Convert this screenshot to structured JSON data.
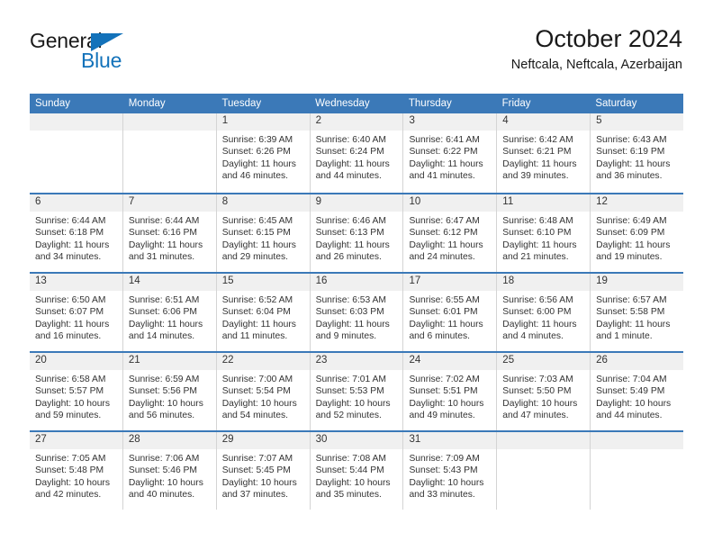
{
  "brand": {
    "name_dark": "General",
    "name_blue": "Blue",
    "triangle_color": "#1372ba"
  },
  "header": {
    "title": "October 2024",
    "subtitle": "Neftcala, Neftcala, Azerbaijan"
  },
  "theme": {
    "header_blue": "#3b79b8",
    "daynum_bg": "#f0f0f0",
    "cell_border": "#d4d4d4",
    "text": "#333333"
  },
  "weekday_headers": [
    "Sunday",
    "Monday",
    "Tuesday",
    "Wednesday",
    "Thursday",
    "Friday",
    "Saturday"
  ],
  "weeks": [
    [
      {
        "day": "",
        "sunrise": "",
        "sunset": "",
        "daylight_1": "",
        "daylight_2": "",
        "empty": true
      },
      {
        "day": "",
        "sunrise": "",
        "sunset": "",
        "daylight_1": "",
        "daylight_2": "",
        "empty": true
      },
      {
        "day": "1",
        "sunrise": "Sunrise: 6:39 AM",
        "sunset": "Sunset: 6:26 PM",
        "daylight_1": "Daylight: 11 hours",
        "daylight_2": "and 46 minutes."
      },
      {
        "day": "2",
        "sunrise": "Sunrise: 6:40 AM",
        "sunset": "Sunset: 6:24 PM",
        "daylight_1": "Daylight: 11 hours",
        "daylight_2": "and 44 minutes."
      },
      {
        "day": "3",
        "sunrise": "Sunrise: 6:41 AM",
        "sunset": "Sunset: 6:22 PM",
        "daylight_1": "Daylight: 11 hours",
        "daylight_2": "and 41 minutes."
      },
      {
        "day": "4",
        "sunrise": "Sunrise: 6:42 AM",
        "sunset": "Sunset: 6:21 PM",
        "daylight_1": "Daylight: 11 hours",
        "daylight_2": "and 39 minutes."
      },
      {
        "day": "5",
        "sunrise": "Sunrise: 6:43 AM",
        "sunset": "Sunset: 6:19 PM",
        "daylight_1": "Daylight: 11 hours",
        "daylight_2": "and 36 minutes."
      }
    ],
    [
      {
        "day": "6",
        "sunrise": "Sunrise: 6:44 AM",
        "sunset": "Sunset: 6:18 PM",
        "daylight_1": "Daylight: 11 hours",
        "daylight_2": "and 34 minutes."
      },
      {
        "day": "7",
        "sunrise": "Sunrise: 6:44 AM",
        "sunset": "Sunset: 6:16 PM",
        "daylight_1": "Daylight: 11 hours",
        "daylight_2": "and 31 minutes."
      },
      {
        "day": "8",
        "sunrise": "Sunrise: 6:45 AM",
        "sunset": "Sunset: 6:15 PM",
        "daylight_1": "Daylight: 11 hours",
        "daylight_2": "and 29 minutes."
      },
      {
        "day": "9",
        "sunrise": "Sunrise: 6:46 AM",
        "sunset": "Sunset: 6:13 PM",
        "daylight_1": "Daylight: 11 hours",
        "daylight_2": "and 26 minutes."
      },
      {
        "day": "10",
        "sunrise": "Sunrise: 6:47 AM",
        "sunset": "Sunset: 6:12 PM",
        "daylight_1": "Daylight: 11 hours",
        "daylight_2": "and 24 minutes."
      },
      {
        "day": "11",
        "sunrise": "Sunrise: 6:48 AM",
        "sunset": "Sunset: 6:10 PM",
        "daylight_1": "Daylight: 11 hours",
        "daylight_2": "and 21 minutes."
      },
      {
        "day": "12",
        "sunrise": "Sunrise: 6:49 AM",
        "sunset": "Sunset: 6:09 PM",
        "daylight_1": "Daylight: 11 hours",
        "daylight_2": "and 19 minutes."
      }
    ],
    [
      {
        "day": "13",
        "sunrise": "Sunrise: 6:50 AM",
        "sunset": "Sunset: 6:07 PM",
        "daylight_1": "Daylight: 11 hours",
        "daylight_2": "and 16 minutes."
      },
      {
        "day": "14",
        "sunrise": "Sunrise: 6:51 AM",
        "sunset": "Sunset: 6:06 PM",
        "daylight_1": "Daylight: 11 hours",
        "daylight_2": "and 14 minutes."
      },
      {
        "day": "15",
        "sunrise": "Sunrise: 6:52 AM",
        "sunset": "Sunset: 6:04 PM",
        "daylight_1": "Daylight: 11 hours",
        "daylight_2": "and 11 minutes."
      },
      {
        "day": "16",
        "sunrise": "Sunrise: 6:53 AM",
        "sunset": "Sunset: 6:03 PM",
        "daylight_1": "Daylight: 11 hours",
        "daylight_2": "and 9 minutes."
      },
      {
        "day": "17",
        "sunrise": "Sunrise: 6:55 AM",
        "sunset": "Sunset: 6:01 PM",
        "daylight_1": "Daylight: 11 hours",
        "daylight_2": "and 6 minutes."
      },
      {
        "day": "18",
        "sunrise": "Sunrise: 6:56 AM",
        "sunset": "Sunset: 6:00 PM",
        "daylight_1": "Daylight: 11 hours",
        "daylight_2": "and 4 minutes."
      },
      {
        "day": "19",
        "sunrise": "Sunrise: 6:57 AM",
        "sunset": "Sunset: 5:58 PM",
        "daylight_1": "Daylight: 11 hours",
        "daylight_2": "and 1 minute."
      }
    ],
    [
      {
        "day": "20",
        "sunrise": "Sunrise: 6:58 AM",
        "sunset": "Sunset: 5:57 PM",
        "daylight_1": "Daylight: 10 hours",
        "daylight_2": "and 59 minutes."
      },
      {
        "day": "21",
        "sunrise": "Sunrise: 6:59 AM",
        "sunset": "Sunset: 5:56 PM",
        "daylight_1": "Daylight: 10 hours",
        "daylight_2": "and 56 minutes."
      },
      {
        "day": "22",
        "sunrise": "Sunrise: 7:00 AM",
        "sunset": "Sunset: 5:54 PM",
        "daylight_1": "Daylight: 10 hours",
        "daylight_2": "and 54 minutes."
      },
      {
        "day": "23",
        "sunrise": "Sunrise: 7:01 AM",
        "sunset": "Sunset: 5:53 PM",
        "daylight_1": "Daylight: 10 hours",
        "daylight_2": "and 52 minutes."
      },
      {
        "day": "24",
        "sunrise": "Sunrise: 7:02 AM",
        "sunset": "Sunset: 5:51 PM",
        "daylight_1": "Daylight: 10 hours",
        "daylight_2": "and 49 minutes."
      },
      {
        "day": "25",
        "sunrise": "Sunrise: 7:03 AM",
        "sunset": "Sunset: 5:50 PM",
        "daylight_1": "Daylight: 10 hours",
        "daylight_2": "and 47 minutes."
      },
      {
        "day": "26",
        "sunrise": "Sunrise: 7:04 AM",
        "sunset": "Sunset: 5:49 PM",
        "daylight_1": "Daylight: 10 hours",
        "daylight_2": "and 44 minutes."
      }
    ],
    [
      {
        "day": "27",
        "sunrise": "Sunrise: 7:05 AM",
        "sunset": "Sunset: 5:48 PM",
        "daylight_1": "Daylight: 10 hours",
        "daylight_2": "and 42 minutes."
      },
      {
        "day": "28",
        "sunrise": "Sunrise: 7:06 AM",
        "sunset": "Sunset: 5:46 PM",
        "daylight_1": "Daylight: 10 hours",
        "daylight_2": "and 40 minutes."
      },
      {
        "day": "29",
        "sunrise": "Sunrise: 7:07 AM",
        "sunset": "Sunset: 5:45 PM",
        "daylight_1": "Daylight: 10 hours",
        "daylight_2": "and 37 minutes."
      },
      {
        "day": "30",
        "sunrise": "Sunrise: 7:08 AM",
        "sunset": "Sunset: 5:44 PM",
        "daylight_1": "Daylight: 10 hours",
        "daylight_2": "and 35 minutes."
      },
      {
        "day": "31",
        "sunrise": "Sunrise: 7:09 AM",
        "sunset": "Sunset: 5:43 PM",
        "daylight_1": "Daylight: 10 hours",
        "daylight_2": "and 33 minutes."
      },
      {
        "day": "",
        "sunrise": "",
        "sunset": "",
        "daylight_1": "",
        "daylight_2": "",
        "empty": true
      },
      {
        "day": "",
        "sunrise": "",
        "sunset": "",
        "daylight_1": "",
        "daylight_2": "",
        "empty": true
      }
    ]
  ]
}
